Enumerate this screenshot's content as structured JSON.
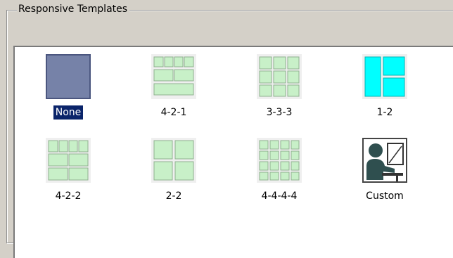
{
  "group": {
    "title": "Responsive Templates"
  },
  "templates": [
    {
      "label": "None",
      "icon": "none-template-icon",
      "selected": true
    },
    {
      "label": "4-2-1",
      "icon": "layout-4-2-1-icon",
      "selected": false
    },
    {
      "label": "3-3-3",
      "icon": "layout-3-3-3-icon",
      "selected": false
    },
    {
      "label": "1-2",
      "icon": "layout-1-2-icon",
      "selected": false
    },
    {
      "label": "4-2-2",
      "icon": "layout-4-2-2-icon",
      "selected": false
    },
    {
      "label": "2-2",
      "icon": "layout-2-2-icon",
      "selected": false
    },
    {
      "label": "4-4-4-4",
      "icon": "layout-4-4-4-4-icon",
      "selected": false
    },
    {
      "label": "Custom",
      "icon": "custom-person-icon",
      "selected": false
    }
  ],
  "colors": {
    "selection_bg": "#0a246a",
    "cell_fill": "#c8f0c8",
    "cyan_fill": "#00ffff",
    "none_fill": "#7682a8"
  }
}
